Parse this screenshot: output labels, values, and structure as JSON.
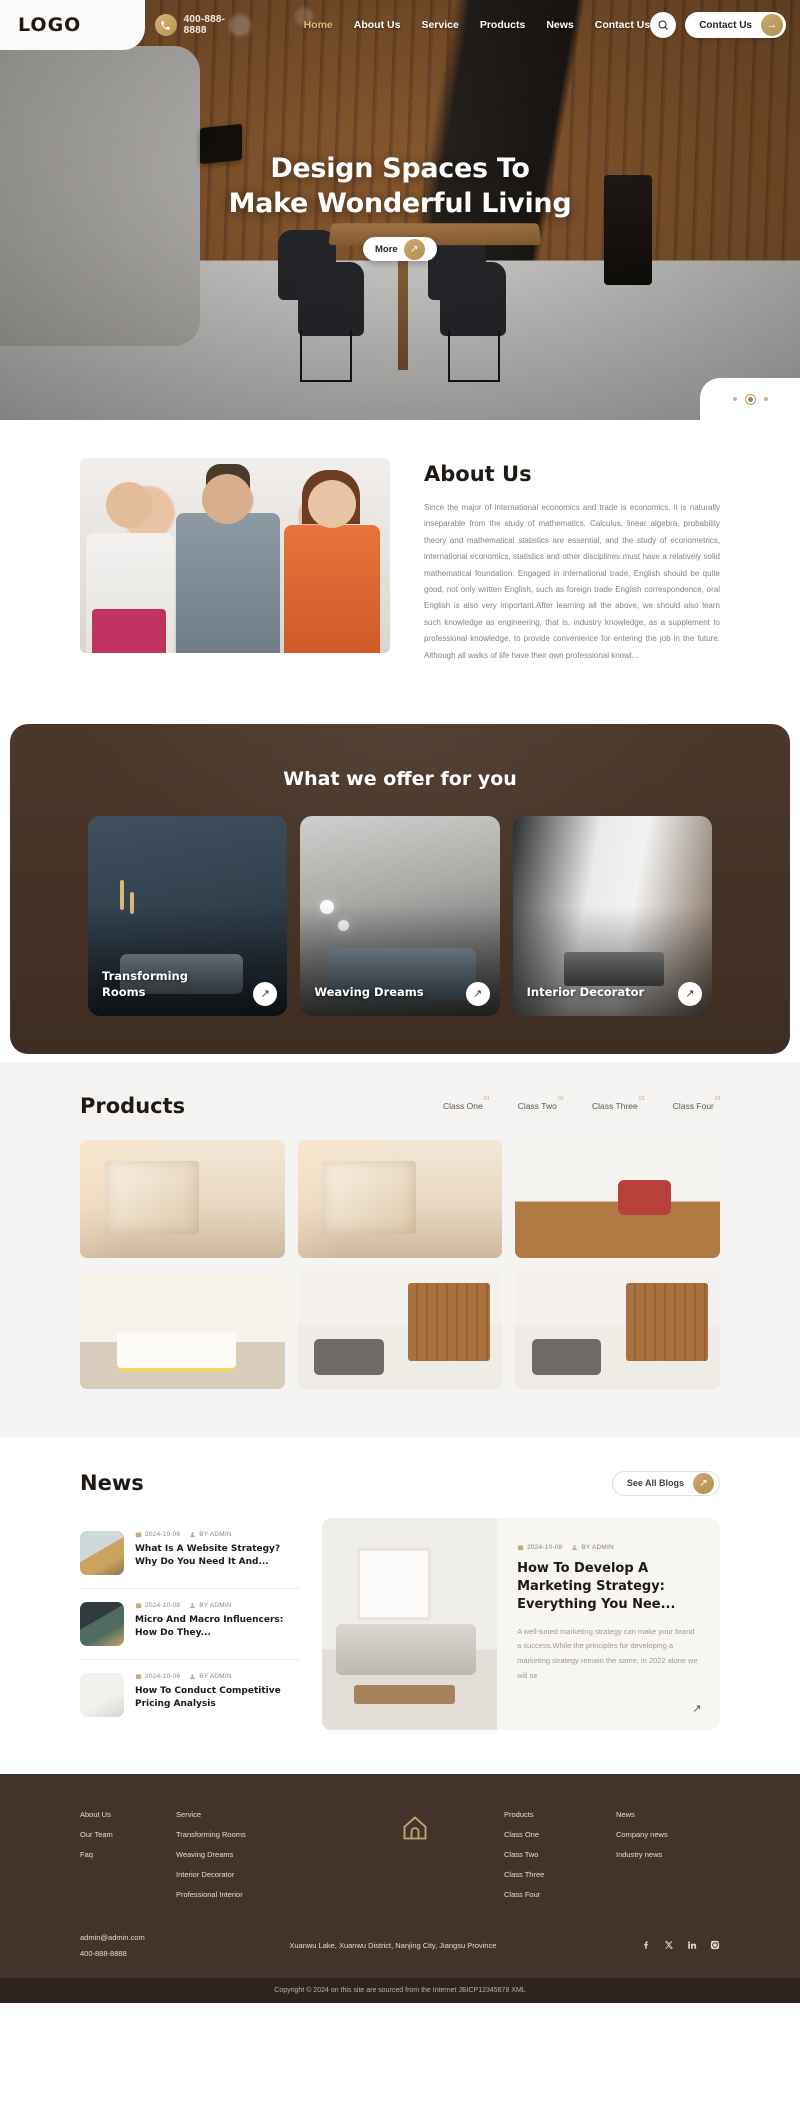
{
  "header": {
    "logo": "LOGO",
    "phone": "400-888-8888",
    "phone_icon": "phone-icon",
    "nav": [
      {
        "label": "Home",
        "active": true
      },
      {
        "label": "About Us",
        "active": false
      },
      {
        "label": "Service",
        "active": false
      },
      {
        "label": "Products",
        "active": false
      },
      {
        "label": "News",
        "active": false
      },
      {
        "label": "Contact Us",
        "active": false
      }
    ],
    "search_icon": "search-icon",
    "contact_button": "Contact Us",
    "contact_arrow": "→"
  },
  "hero": {
    "title_line1": "Design Spaces To",
    "title_line2": "Make Wonderful Living",
    "more_label": "More",
    "more_arrow": "↗",
    "carousel_dots": 3,
    "active_dot": 1
  },
  "about": {
    "title": "About Us",
    "text": "Since the major of international economics and trade is economics, it is naturally inseparable from the study of mathematics. Calculus, linear algebra, probability theory and mathematical statistics are essential, and the study of econometrics, international economics, statistics and other disciplines must have a relatively solid mathematical foundation. Engaged in international trade, English should be quite good, not only written English, such as foreign trade English correspondence, oral English is also very important.After learning all the above, we should also learn such knowledge as engineering, that is, industry knowledge, as a supplement to professional knowledge, to provide convenience for entering the job in the future. Although all walks of life have their own professional knowl..."
  },
  "offer": {
    "title": "What we offer for you",
    "cards": [
      {
        "label": "Transforming Rooms",
        "arrow": "↗"
      },
      {
        "label": "Weaving Dreams",
        "arrow": "↗"
      },
      {
        "label": "Interior Decorator",
        "arrow": "↗"
      }
    ]
  },
  "products": {
    "title": "Products",
    "tabs": [
      {
        "label": "Class One",
        "sup": "01"
      },
      {
        "label": "Class Two",
        "sup": "01"
      },
      {
        "label": "Class Three",
        "sup": "01"
      },
      {
        "label": "Class Four",
        "sup": "01"
      }
    ],
    "items": [
      {
        "name": "product-staircase-lounge-1"
      },
      {
        "name": "product-staircase-lounge-2"
      },
      {
        "name": "product-office-study"
      },
      {
        "name": "product-bedroom"
      },
      {
        "name": "product-kitchen-1"
      },
      {
        "name": "product-kitchen-2"
      }
    ]
  },
  "news": {
    "title": "News",
    "see_all_label": "See All Blogs",
    "see_all_arrow": "↗",
    "date_icon": "calendar-icon",
    "author_icon": "user-icon",
    "list": [
      {
        "date": "2024-10-08",
        "author": "BY ADMIN",
        "title": "What Is A Website Strategy? Why Do You Need It And..."
      },
      {
        "date": "2024-10-08",
        "author": "BY ADMIN",
        "title": "Micro And Macro Influencers: How Do They..."
      },
      {
        "date": "2024-10-08",
        "author": "BY ADMIN",
        "title": "How To Conduct Competitive Pricing Analysis"
      }
    ],
    "feature": {
      "date": "2024-10-08",
      "author": "BY ADMIN",
      "title": "How To Develop A Marketing Strategy: Everything You Nee...",
      "desc": "A well-tuned marketing strategy can make your brand a success.While the principles for developing a marketing strategy remain the same, in 2022 alone we will se",
      "arrow": "↗"
    }
  },
  "footer": {
    "columns": [
      {
        "links": [
          "About Us",
          "Our Team",
          "Faq"
        ]
      },
      {
        "links": [
          "Service",
          "Transforming Rooms",
          "Weaving Dreams",
          "Interior Decorator",
          "Professional Interior"
        ]
      },
      {
        "links": [
          "Products",
          "Class One",
          "Class Two",
          "Class Three",
          "Class Four"
        ]
      },
      {
        "links": [
          "News",
          "Company news",
          "Industry news"
        ]
      }
    ],
    "logo_icon": "house-icon",
    "email": "admin@admin.com",
    "phone": "400-888-8888",
    "address": "Xuanwu Lake, Xuanwu District, Nanjing City, Jiangsu Province",
    "social": [
      "facebook-icon",
      "x-icon",
      "linkedin-icon",
      "instagram-icon"
    ],
    "copyright": "Copyright © 2024 on this site are sourced from the Internet JБICP12345678 XML"
  },
  "colors": {
    "brand_gold": "#c2a474",
    "dark_brown": "#43332a",
    "offer_bg": "#4b372a"
  }
}
